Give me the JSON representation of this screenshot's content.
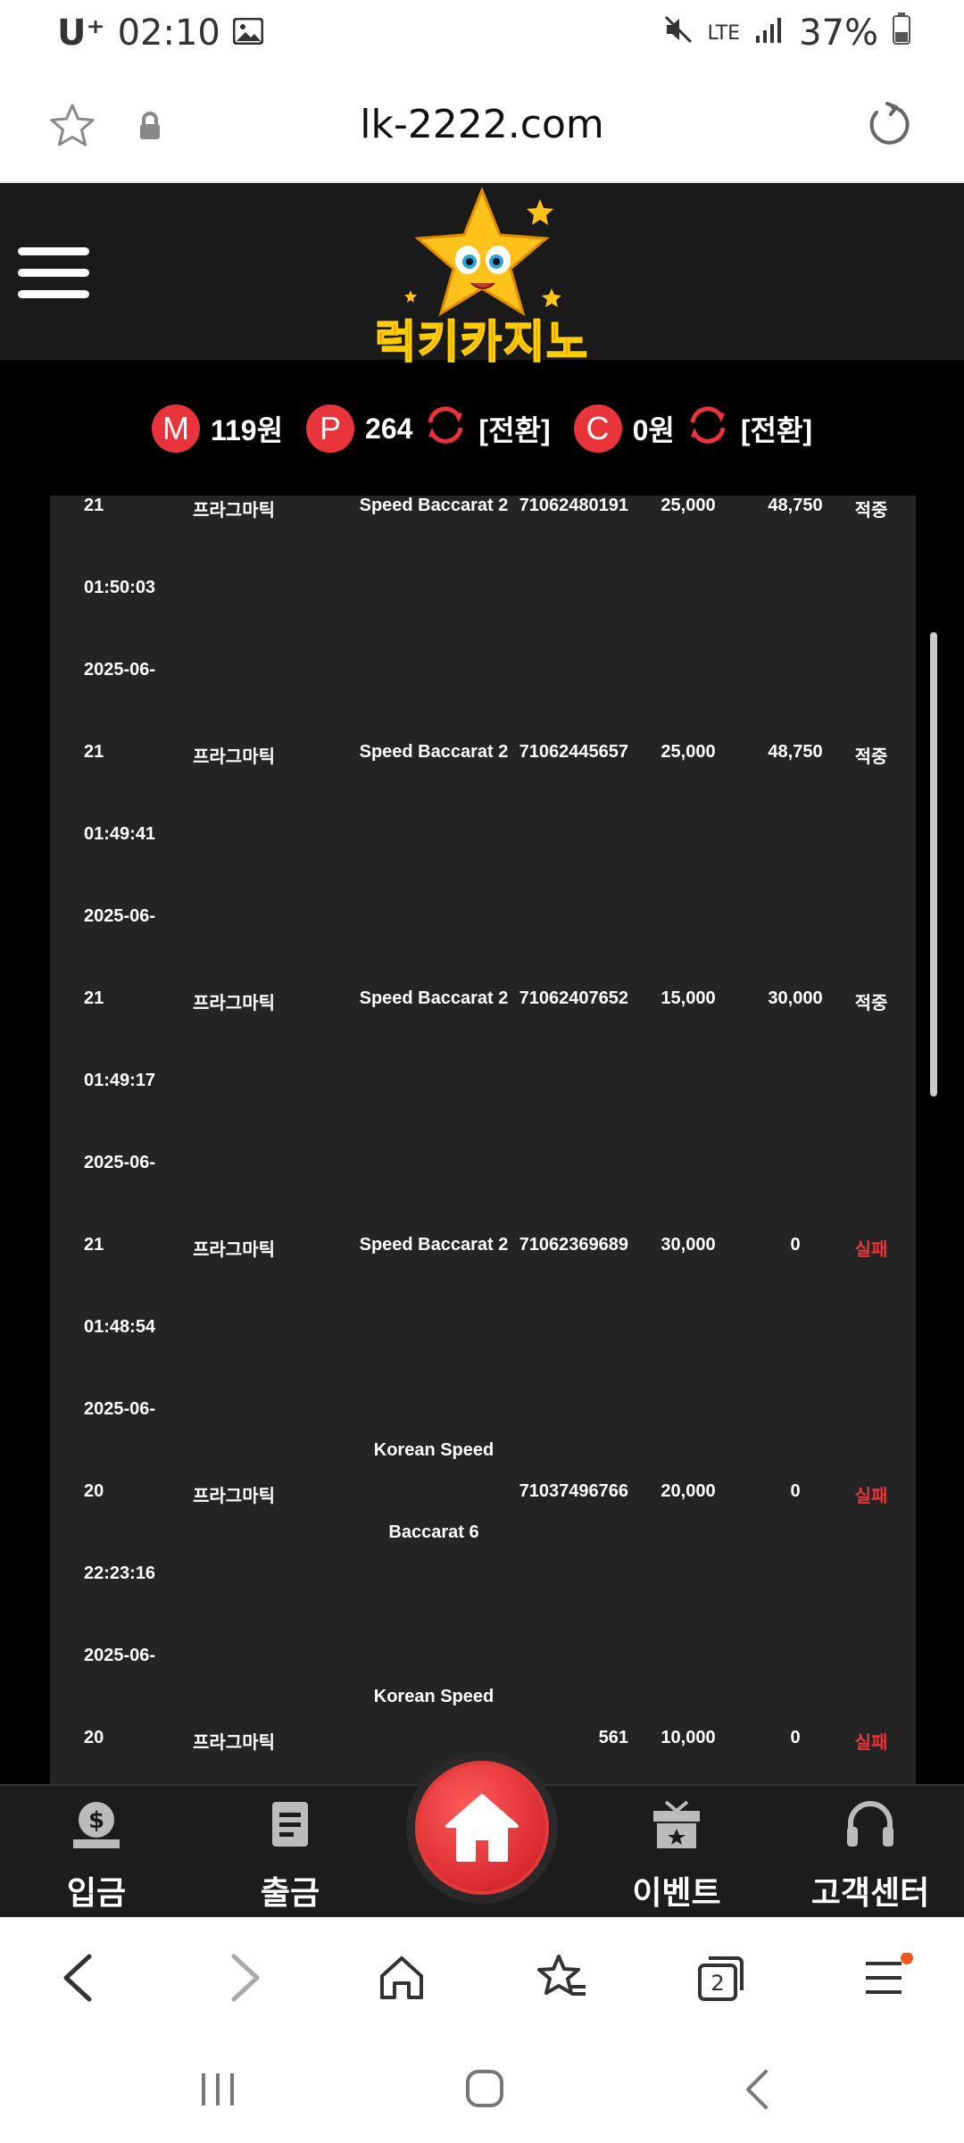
{
  "status_bar": {
    "carrier": "U⁺",
    "time": "02:10",
    "battery": "37%",
    "network": "LTE"
  },
  "browser": {
    "url": "lk-2222.com"
  },
  "site": {
    "logo_text": "럭키카지노"
  },
  "balance": {
    "m_badge": "M",
    "m_value": "119원",
    "p_badge": "P",
    "p_value": "264",
    "p_convert": "[전환]",
    "c_badge": "C",
    "c_value": "0원",
    "c_convert": "[전환]"
  },
  "bets": [
    {
      "date": "",
      "day": "21",
      "time": "01:50:03",
      "provider": "프라그마틱",
      "game1": "Speed Baccarat 2",
      "game2": "",
      "id": "71062480191",
      "bet": "25,000",
      "win": "48,750",
      "result": "적중",
      "lost": false
    },
    {
      "date": "2025-06-",
      "day": "21",
      "time": "01:49:41",
      "provider": "프라그마틱",
      "game1": "Speed Baccarat 2",
      "game2": "",
      "id": "71062445657",
      "bet": "25,000",
      "win": "48,750",
      "result": "적중",
      "lost": false
    },
    {
      "date": "2025-06-",
      "day": "21",
      "time": "01:49:17",
      "provider": "프라그마틱",
      "game1": "Speed Baccarat 2",
      "game2": "",
      "id": "71062407652",
      "bet": "15,000",
      "win": "30,000",
      "result": "적중",
      "lost": false
    },
    {
      "date": "2025-06-",
      "day": "21",
      "time": "01:48:54",
      "provider": "프라그마틱",
      "game1": "Speed Baccarat 2",
      "game2": "",
      "id": "71062369689",
      "bet": "30,000",
      "win": "0",
      "result": "실패",
      "lost": true
    },
    {
      "date": "2025-06-",
      "day": "20",
      "time": "22:23:16",
      "provider": "프라그마틱",
      "game1": "Korean Speed",
      "game2": "Baccarat 6",
      "id": "71037496766",
      "bet": "20,000",
      "win": "0",
      "result": "실패",
      "lost": true
    },
    {
      "date": "2025-06-",
      "day": "20",
      "time": "",
      "provider": "프라그마틱",
      "game1": "Korean Speed",
      "game2": "",
      "id": "561",
      "bet": "10,000",
      "win": "0",
      "result": "실패",
      "lost": true
    }
  ],
  "bottom_nav": {
    "deposit": "입금",
    "withdraw": "출금",
    "event": "이벤트",
    "support": "고객센터"
  },
  "colors": {
    "accent_red": "#e8343a",
    "panel": "#242424",
    "header": "#1a1a1a"
  }
}
